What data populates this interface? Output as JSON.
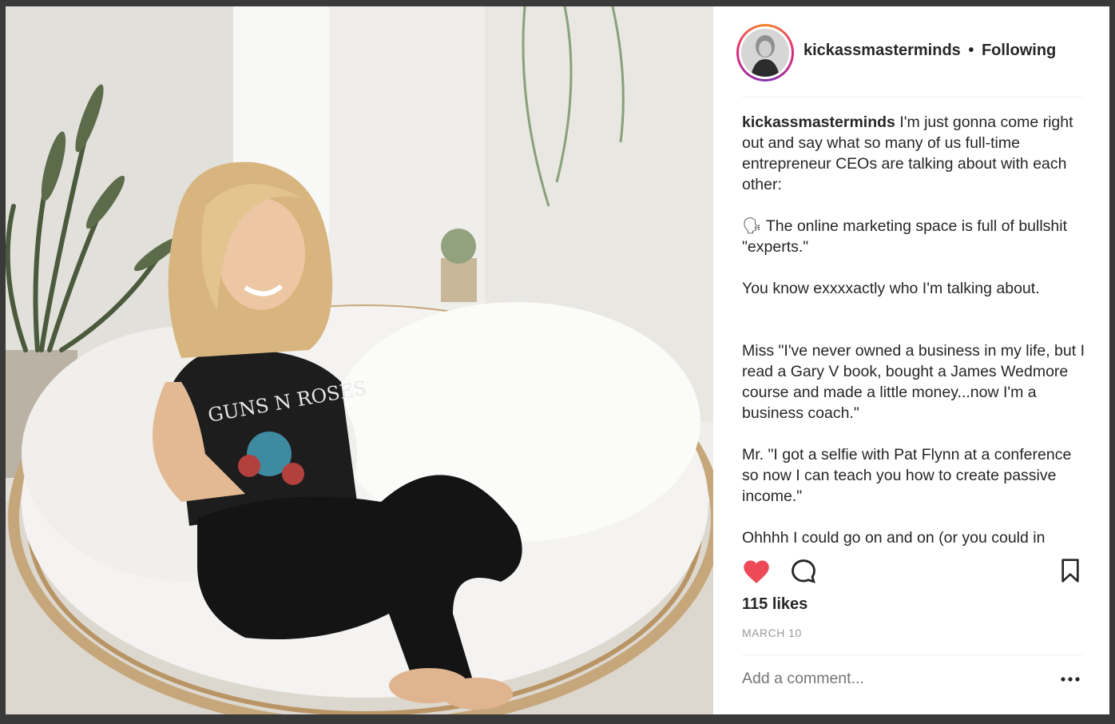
{
  "post": {
    "username": "kickassmasterminds",
    "separator": "•",
    "follow_status": "Following",
    "caption": {
      "username": "kickassmasterminds",
      "paragraphs": [
        "I'm just gonna come right out and say what so many of us full-time entrepreneur CEOs are talking about with each other:",
        "🗣 The online marketing space is full of bullshit \"experts.\"",
        "You know exxxxactly who I'm talking about.",
        "Miss \"I've never owned a business in my life, but I read a Gary V book, bought a James Wedmore course and made a little money...now I'm a business coach.\"",
        "Mr. \"I got a selfie with Pat Flynn at a conference so now I can teach you how to create passive income.\"",
        "Ohhhh I could go on and on (or you could in"
      ]
    },
    "likes": "115 likes",
    "date": "MARCH 10",
    "comment_placeholder": "Add a comment...",
    "icons": {
      "like": "heart-icon",
      "comment": "comment-bubble-icon",
      "save": "bookmark-icon",
      "more": "ellipsis-icon"
    },
    "colors": {
      "heart": "#ed4956",
      "text": "#262626",
      "muted": "#999999"
    }
  }
}
